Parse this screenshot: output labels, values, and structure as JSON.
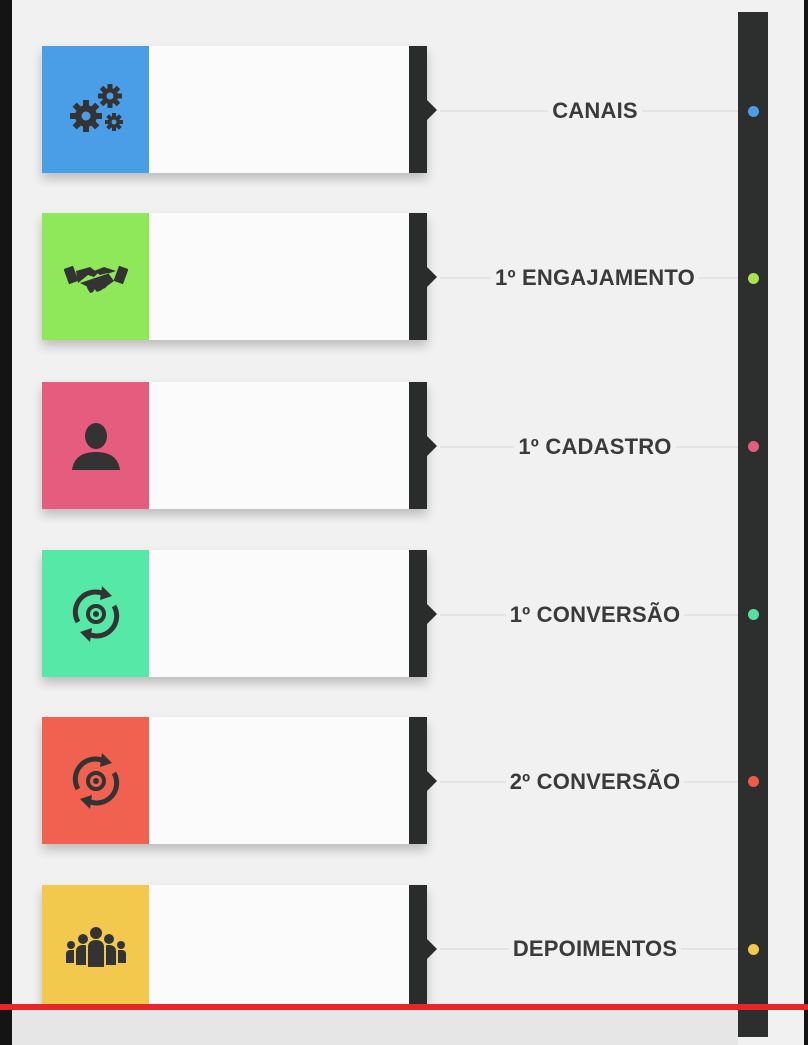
{
  "steps": [
    {
      "label": "CANAIS",
      "icon": "gears-icon",
      "color": "#4a9ee8",
      "dot_color": "#4a9ee8"
    },
    {
      "label": "1º ENGAJAMENTO",
      "icon": "handshake-icon",
      "color": "#8ee85a",
      "dot_color": "#a9e34e"
    },
    {
      "label": "1º CADASTRO",
      "icon": "user-icon",
      "color": "#e65c7e",
      "dot_color": "#e65c7e"
    },
    {
      "label": "1º CONVERSÃO",
      "icon": "target-cycle-icon",
      "color": "#55e8a6",
      "dot_color": "#55e0a0"
    },
    {
      "label": "2º CONVERSÃO",
      "icon": "target-cycle-icon",
      "color": "#f0624f",
      "dot_color": "#ee5b48"
    },
    {
      "label": "DEPOIMENTOS",
      "icon": "group-icon",
      "color": "#f2c94c",
      "dot_color": "#f2c94c"
    }
  ]
}
